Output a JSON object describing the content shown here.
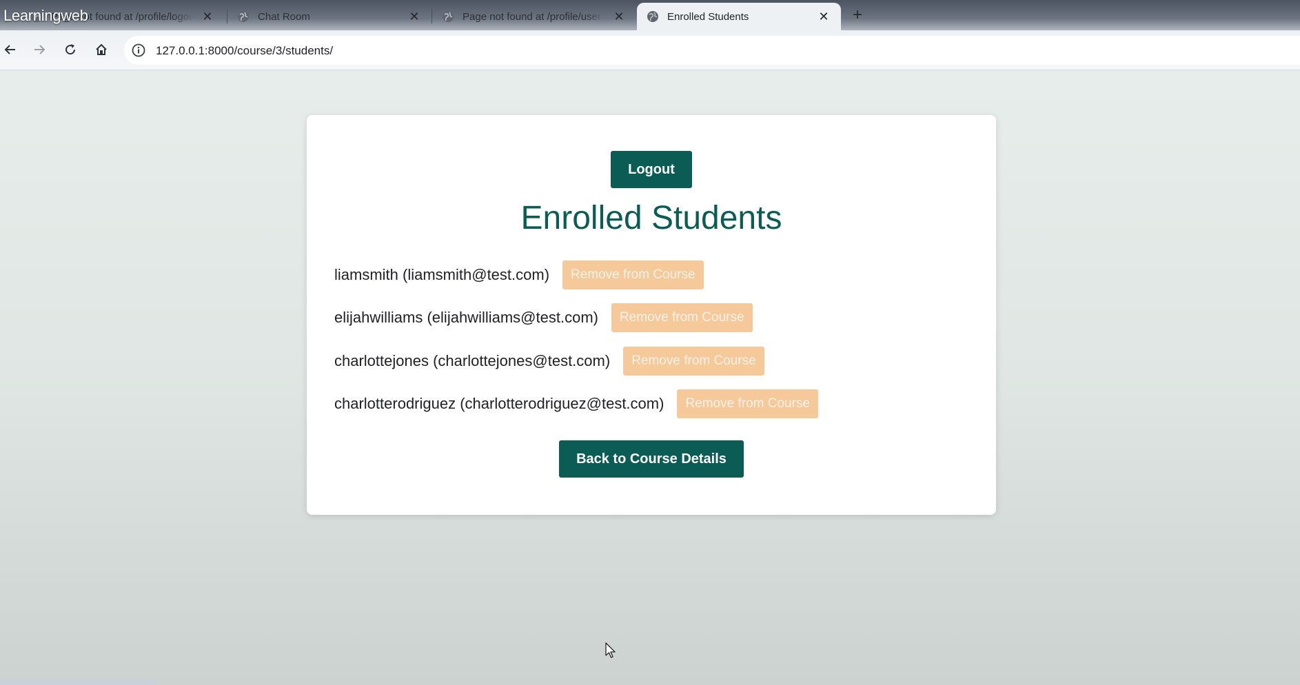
{
  "watermark": "Learningweb",
  "tabs": [
    {
      "title": "Page not found at /profile/logout",
      "active": false
    },
    {
      "title": "Chat Room",
      "active": false
    },
    {
      "title": "Page not found at /profile/user",
      "active": false
    },
    {
      "title": "Enrolled Students",
      "active": true
    }
  ],
  "new_tab_label": "+",
  "address_bar": {
    "url": "127.0.0.1:8000/course/3/students/"
  },
  "page": {
    "logout_label": "Logout",
    "title": "Enrolled Students",
    "students": [
      {
        "text": "liamsmith (liamsmith@test.com)",
        "action": "Remove from Course"
      },
      {
        "text": "elijahwilliams (elijahwilliams@test.com)",
        "action": "Remove from Course"
      },
      {
        "text": "charlottejones (charlottejones@test.com)",
        "action": "Remove from Course"
      },
      {
        "text": "charlotterodriguez (charlotterodriguez@test.com)",
        "action": "Remove from Course"
      }
    ],
    "back_label": "Back to Course Details"
  },
  "colors": {
    "primary": "#0b5c55",
    "remove_button": "#f6c99a",
    "remove_text": "#fbf3ea",
    "card": "#ffffff"
  },
  "icons": {
    "tab": "globe-icon",
    "tab_close": "close-icon",
    "back": "arrow-left-icon",
    "forward": "arrow-right-icon",
    "reload": "reload-icon",
    "home": "home-icon",
    "site_info": "info-icon"
  }
}
